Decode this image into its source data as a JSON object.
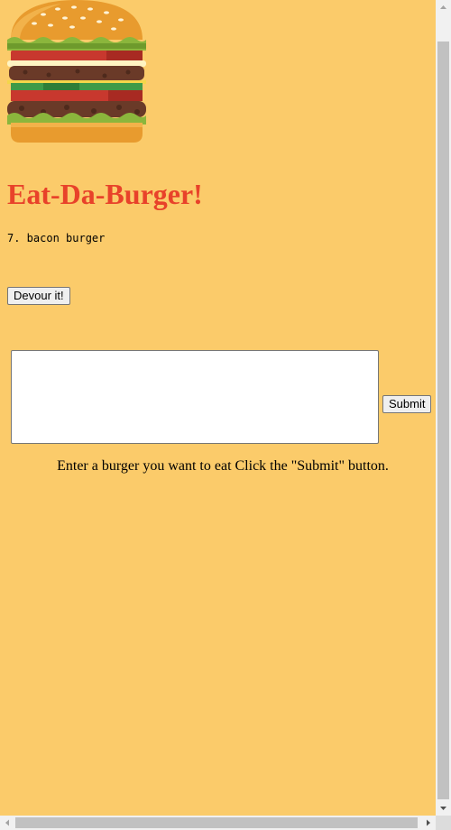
{
  "header": {
    "logo_icon": "burger-icon",
    "title": "Eat-Da-Burger!",
    "title_color": "#E8422A"
  },
  "burgers": [
    {
      "label": "7. bacon burger"
    }
  ],
  "devour_button_label": "Devour it!",
  "form": {
    "textarea_value": "",
    "submit_label": "Submit"
  },
  "instructions": "Enter a burger you want to eat Click the \"Submit\" button.",
  "colors": {
    "background": "#FBCB6A"
  }
}
